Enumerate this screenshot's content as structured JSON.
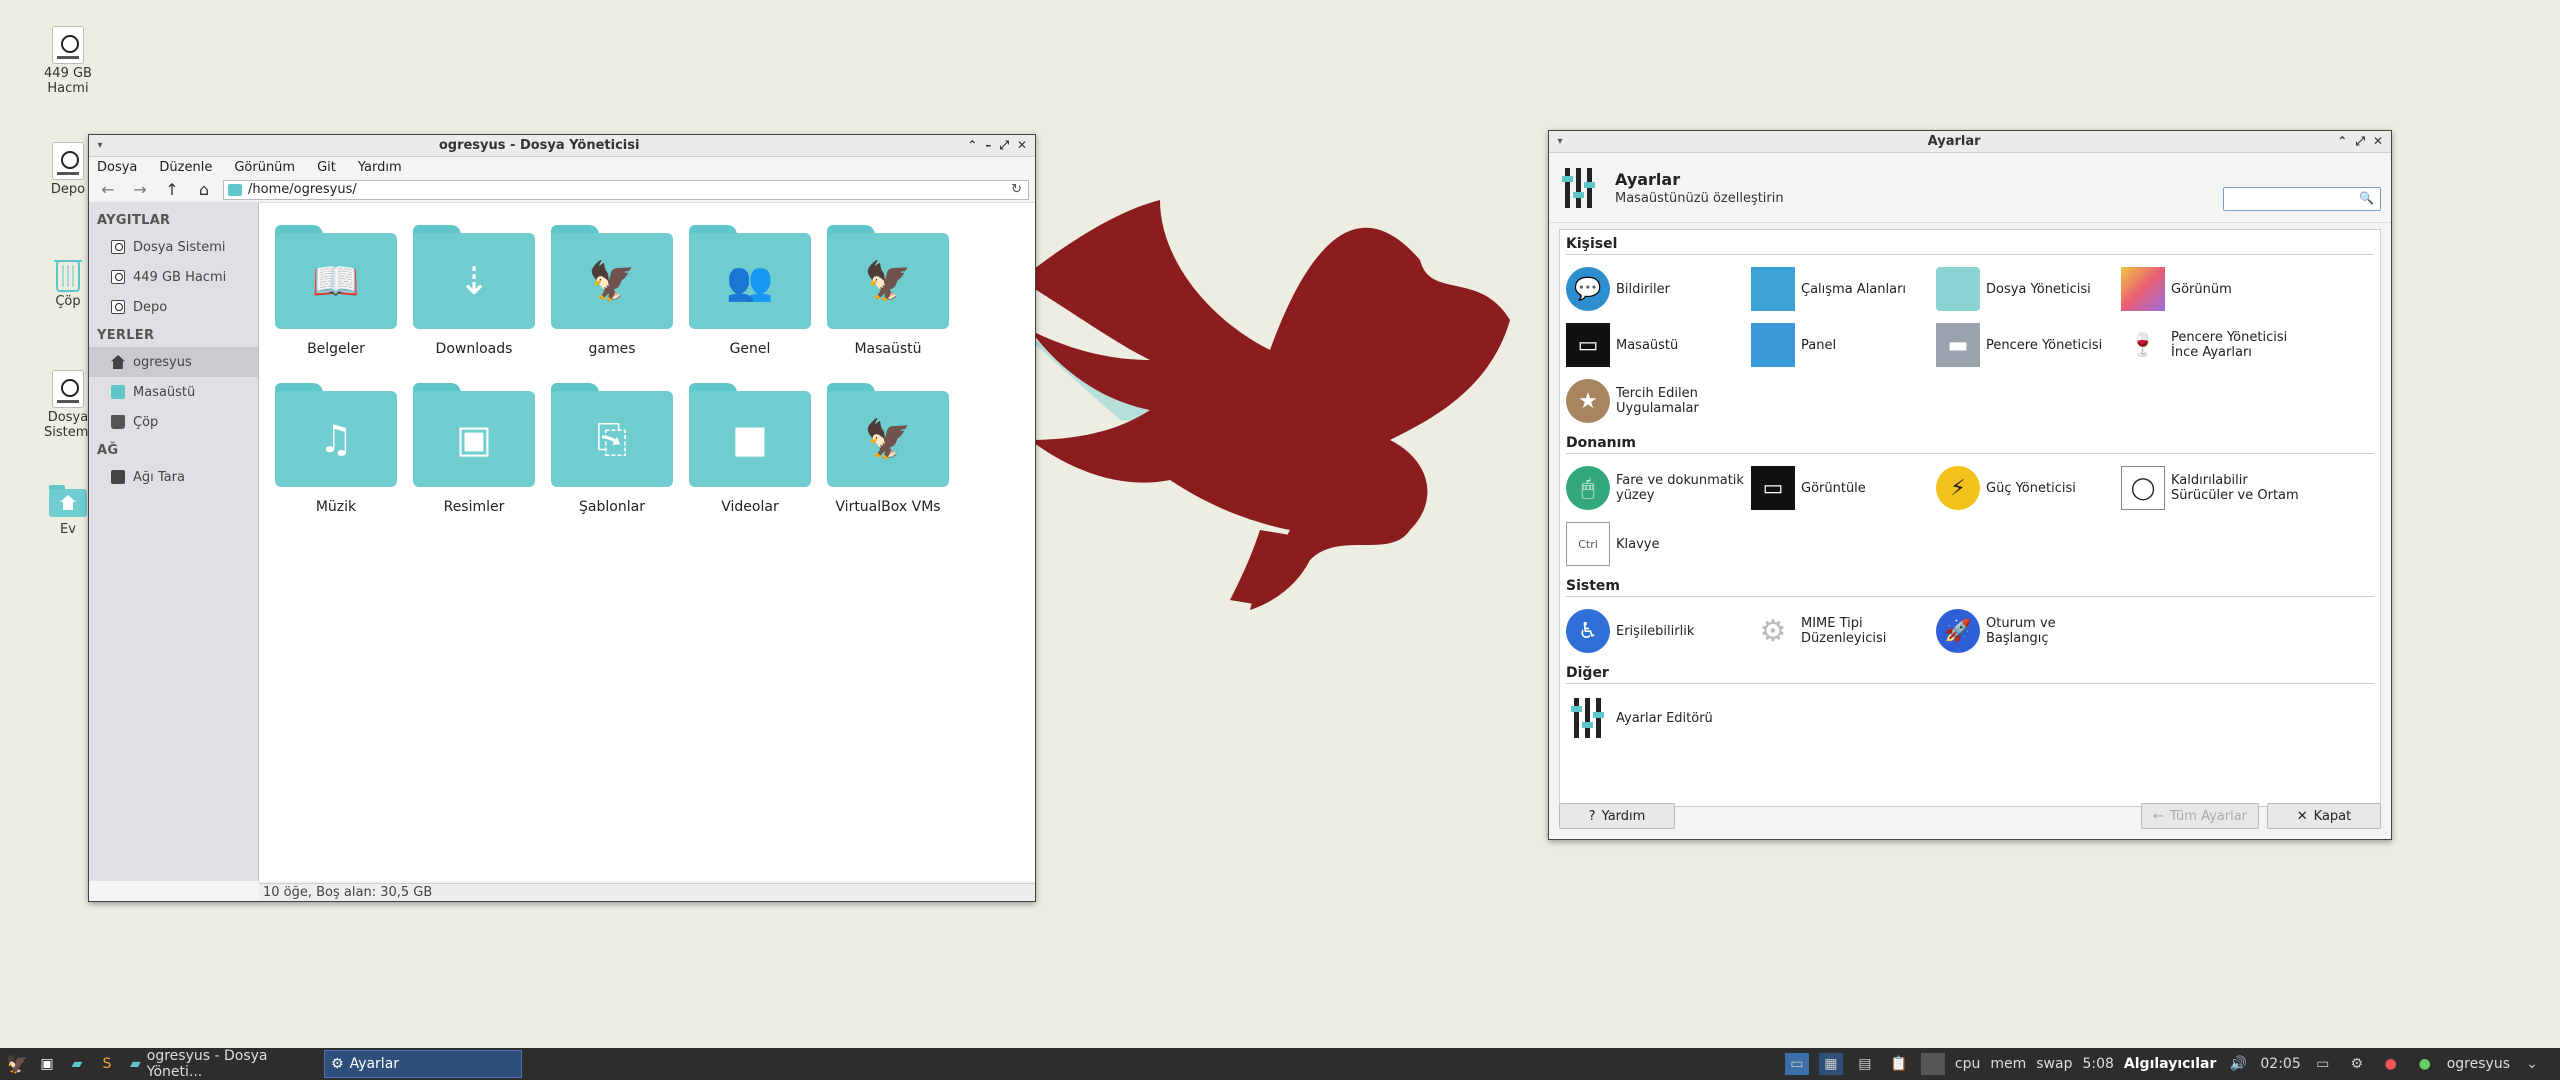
{
  "desktop": {
    "icons": [
      {
        "label": "449 GB\nHacmi",
        "icon": "drive-icon"
      },
      {
        "label": "Depo",
        "icon": "drive-icon"
      },
      {
        "label": "Çöp",
        "icon": "trash-icon"
      },
      {
        "label": "Dosya\nSistemi",
        "icon": "drive-icon"
      },
      {
        "label": "Ev",
        "icon": "home-folder-icon"
      }
    ]
  },
  "file_manager": {
    "title": "ogresyus - Dosya Yöneticisi",
    "menu": [
      "Dosya",
      "Düzenle",
      "Görünüm",
      "Git",
      "Yardım"
    ],
    "address": "/home/ogresyus/",
    "sidebar": {
      "sections": [
        {
          "header": "AYGITLAR",
          "items": [
            "Dosya Sistemi",
            "449 GB Hacmi",
            "Depo"
          ]
        },
        {
          "header": "YERLER",
          "items": [
            "ogresyus",
            "Masaüstü",
            "Çöp"
          ]
        },
        {
          "header": "AĞ",
          "items": [
            "Ağı Tara"
          ]
        }
      ]
    },
    "folders": [
      {
        "name": "Belgeler",
        "glyph": "📖"
      },
      {
        "name": "Downloads",
        "glyph": "⇣"
      },
      {
        "name": "games",
        "glyph": "🦅"
      },
      {
        "name": "Genel",
        "glyph": "👥"
      },
      {
        "name": "Masaüstü",
        "glyph": "🦅"
      },
      {
        "name": "Müzik",
        "glyph": "♫"
      },
      {
        "name": "Resimler",
        "glyph": "▣"
      },
      {
        "name": "Şablonlar",
        "glyph": "⎘"
      },
      {
        "name": "Videolar",
        "glyph": "■"
      },
      {
        "name": "VirtualBox VMs",
        "glyph": "🦅"
      }
    ],
    "status": "10 öğe, Boş alan: 30,5 GB"
  },
  "settings": {
    "title": "Ayarlar",
    "header_title": "Ayarlar",
    "header_subtitle": "Masaüstünüzü özelleştirin",
    "search_placeholder": "",
    "sections": [
      {
        "header": "Kişisel",
        "items": [
          "Bildiriler",
          "Çalışma Alanları",
          "Dosya Yöneticisi",
          "Görünüm",
          "Masaüstü",
          "Panel",
          "Pencere Yöneticisi",
          "Pencere Yöneticisi İnce Ayarları",
          "Tercih Edilen Uygulamalar"
        ]
      },
      {
        "header": "Donanım",
        "items": [
          "Fare ve dokunmatik yüzey",
          "Görüntüle",
          "Güç Yöneticisi",
          "Kaldırılabilir Sürücüler ve Ortam",
          "Klavye"
        ]
      },
      {
        "header": "Sistem",
        "items": [
          "Erişilebilirlik",
          "MIME Tipi Düzenleyicisi",
          "Oturum ve Başlangıç"
        ]
      },
      {
        "header": "Diğer",
        "items": [
          "Ayarlar Editörü"
        ]
      }
    ],
    "buttons": {
      "help": "Yardım",
      "all": "Tüm Ayarlar",
      "close": "Kapat"
    }
  },
  "taskbar": {
    "tasks": [
      "ogresyus - Dosya Yöneti...",
      "Ayarlar"
    ],
    "tray": {
      "cpu": "cpu",
      "mem": "mem",
      "swap": "swap",
      "time_small": "5:08",
      "sensors": "Algılayıcılar",
      "clock": "02:05",
      "user": "ogresyus"
    }
  },
  "colors": {
    "accent": "#5fc6c9",
    "eagle": "#8b1d1f",
    "desktop": "#eeede2",
    "taskbar": "#2d2d2d"
  }
}
